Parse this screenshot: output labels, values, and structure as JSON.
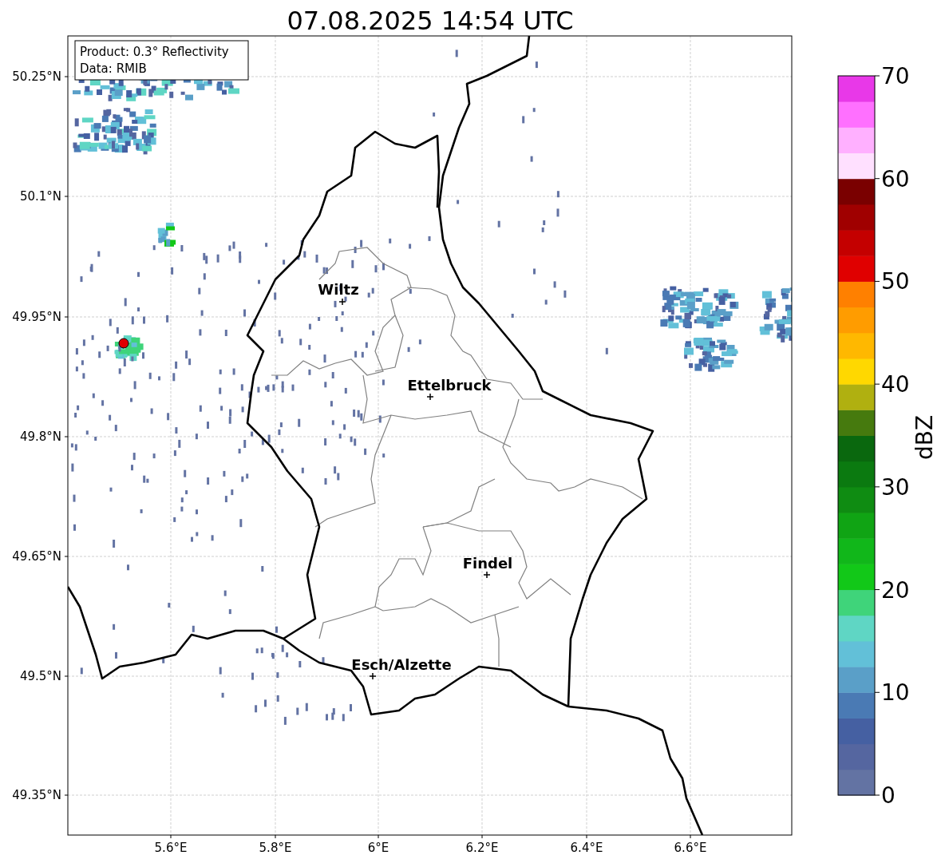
{
  "title": "07.08.2025 14:54 UTC",
  "info_box": [
    "Product: 0.3° Reflectivity",
    "Data: RMIB"
  ],
  "cities": [
    {
      "name": "Wiltz"
    },
    {
      "name": "Ettelbruck"
    },
    {
      "name": "Findel"
    },
    {
      "name": "Esch/Alzette"
    }
  ],
  "lat_ticks": [
    "50.25°N",
    "50.1°N",
    "49.95°N",
    "49.8°N",
    "49.65°N",
    "49.5°N",
    "49.35°N"
  ],
  "lon_ticks": [
    "5.6°E",
    "5.8°E",
    "6°E",
    "6.2°E",
    "6.4°E",
    "6.6°E"
  ],
  "colorbar": {
    "label": "dBZ",
    "ticks": [
      "70",
      "60",
      "50",
      "40",
      "30",
      "20",
      "10",
      "0"
    ],
    "levels": [
      {
        "color": "#6373a3"
      },
      {
        "color": "#5566a0"
      },
      {
        "color": "#4560a2"
      },
      {
        "color": "#4a7ab4"
      },
      {
        "color": "#5a9fc8"
      },
      {
        "color": "#62c0d8"
      },
      {
        "color": "#5fd6c4"
      },
      {
        "color": "#3fd47a"
      },
      {
        "color": "#12c818"
      },
      {
        "color": "#11b71a"
      },
      {
        "color": "#10a414"
      },
      {
        "color": "#0f8c12"
      },
      {
        "color": "#0b7a10"
      },
      {
        "color": "#0a680e"
      },
      {
        "color": "#467a0e"
      },
      {
        "color": "#b0b010"
      },
      {
        "color": "#ffd800"
      },
      {
        "color": "#ffb800"
      },
      {
        "color": "#ff9c00"
      },
      {
        "color": "#ff8000"
      },
      {
        "color": "#e00000"
      },
      {
        "color": "#c40000"
      },
      {
        "color": "#a00000"
      },
      {
        "color": "#7a0000"
      },
      {
        "color": "#ffe0ff"
      },
      {
        "color": "#ffb0ff"
      },
      {
        "color": "#ff70ff"
      },
      {
        "color": "#e838e8"
      }
    ]
  }
}
